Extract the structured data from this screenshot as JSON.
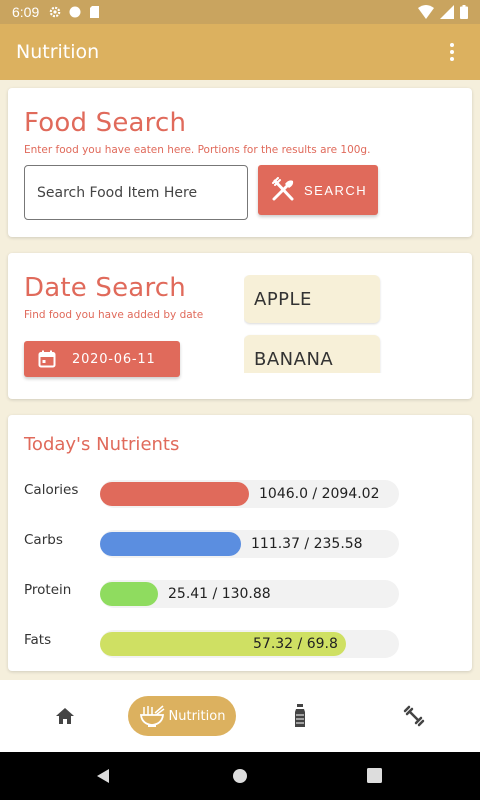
{
  "status_bar": {
    "time": "6:09"
  },
  "app_bar": {
    "title": "Nutrition"
  },
  "food_search": {
    "heading": "Food Search",
    "subtitle": "Enter food you have eaten here. Portions for the results are 100g.",
    "placeholder": "Search Food Item Here",
    "button_label": "SEARCH"
  },
  "date_search": {
    "heading": "Date Search",
    "subtitle": "Find food you have added by date",
    "date": "2020-06-11",
    "foods": [
      "APPLE",
      "BANANA"
    ]
  },
  "nutrients": {
    "heading": "Today's Nutrients",
    "items": [
      {
        "label": "Calories",
        "value": "1046.0 / 2094.02",
        "fraction": 0.4995,
        "color": "#e06a5b"
      },
      {
        "label": "Carbs",
        "value": "111.37 / 235.58",
        "fraction": 0.4727,
        "color": "#5b8ee0"
      },
      {
        "label": "Protein",
        "value": "25.41 / 130.88",
        "fraction": 0.1941,
        "color": "#8fdc5f"
      },
      {
        "label": "Fats",
        "value": "57.32 / 69.8",
        "fraction": 0.8212,
        "color": "#cfe063"
      }
    ]
  },
  "bottom_nav": {
    "items": [
      {
        "icon": "home-icon"
      },
      {
        "icon": "noodles-icon",
        "label": "Nutrition"
      },
      {
        "icon": "water-bottle-icon"
      },
      {
        "icon": "dumbbell-icon"
      }
    ]
  },
  "colors": {
    "accent": "#e06a5b",
    "brand": "#dcb15f",
    "background": "#f5efdc"
  }
}
